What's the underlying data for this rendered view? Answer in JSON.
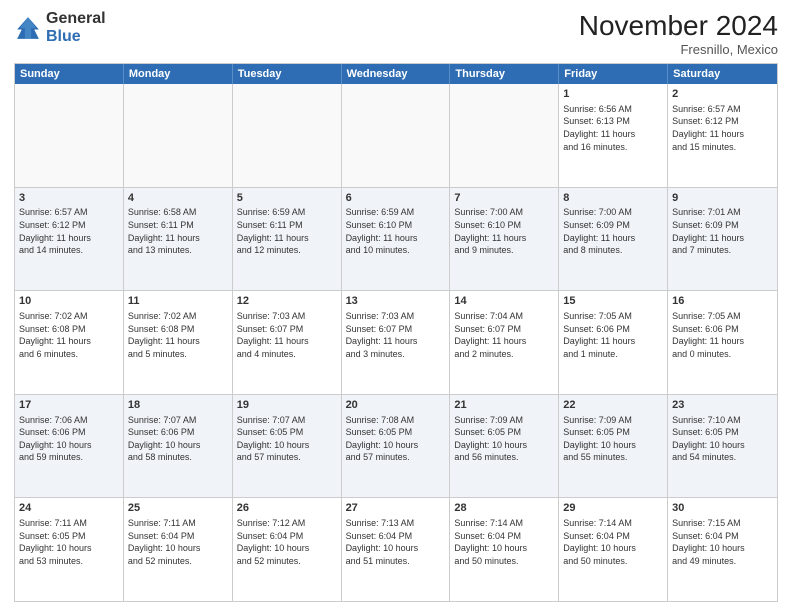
{
  "header": {
    "logo_general": "General",
    "logo_blue": "Blue",
    "month_title": "November 2024",
    "location": "Fresnillo, Mexico"
  },
  "weekdays": [
    "Sunday",
    "Monday",
    "Tuesday",
    "Wednesday",
    "Thursday",
    "Friday",
    "Saturday"
  ],
  "rows": [
    [
      {
        "day": "",
        "info": ""
      },
      {
        "day": "",
        "info": ""
      },
      {
        "day": "",
        "info": ""
      },
      {
        "day": "",
        "info": ""
      },
      {
        "day": "",
        "info": ""
      },
      {
        "day": "1",
        "info": "Sunrise: 6:56 AM\nSunset: 6:13 PM\nDaylight: 11 hours\nand 16 minutes."
      },
      {
        "day": "2",
        "info": "Sunrise: 6:57 AM\nSunset: 6:12 PM\nDaylight: 11 hours\nand 15 minutes."
      }
    ],
    [
      {
        "day": "3",
        "info": "Sunrise: 6:57 AM\nSunset: 6:12 PM\nDaylight: 11 hours\nand 14 minutes."
      },
      {
        "day": "4",
        "info": "Sunrise: 6:58 AM\nSunset: 6:11 PM\nDaylight: 11 hours\nand 13 minutes."
      },
      {
        "day": "5",
        "info": "Sunrise: 6:59 AM\nSunset: 6:11 PM\nDaylight: 11 hours\nand 12 minutes."
      },
      {
        "day": "6",
        "info": "Sunrise: 6:59 AM\nSunset: 6:10 PM\nDaylight: 11 hours\nand 10 minutes."
      },
      {
        "day": "7",
        "info": "Sunrise: 7:00 AM\nSunset: 6:10 PM\nDaylight: 11 hours\nand 9 minutes."
      },
      {
        "day": "8",
        "info": "Sunrise: 7:00 AM\nSunset: 6:09 PM\nDaylight: 11 hours\nand 8 minutes."
      },
      {
        "day": "9",
        "info": "Sunrise: 7:01 AM\nSunset: 6:09 PM\nDaylight: 11 hours\nand 7 minutes."
      }
    ],
    [
      {
        "day": "10",
        "info": "Sunrise: 7:02 AM\nSunset: 6:08 PM\nDaylight: 11 hours\nand 6 minutes."
      },
      {
        "day": "11",
        "info": "Sunrise: 7:02 AM\nSunset: 6:08 PM\nDaylight: 11 hours\nand 5 minutes."
      },
      {
        "day": "12",
        "info": "Sunrise: 7:03 AM\nSunset: 6:07 PM\nDaylight: 11 hours\nand 4 minutes."
      },
      {
        "day": "13",
        "info": "Sunrise: 7:03 AM\nSunset: 6:07 PM\nDaylight: 11 hours\nand 3 minutes."
      },
      {
        "day": "14",
        "info": "Sunrise: 7:04 AM\nSunset: 6:07 PM\nDaylight: 11 hours\nand 2 minutes."
      },
      {
        "day": "15",
        "info": "Sunrise: 7:05 AM\nSunset: 6:06 PM\nDaylight: 11 hours\nand 1 minute."
      },
      {
        "day": "16",
        "info": "Sunrise: 7:05 AM\nSunset: 6:06 PM\nDaylight: 11 hours\nand 0 minutes."
      }
    ],
    [
      {
        "day": "17",
        "info": "Sunrise: 7:06 AM\nSunset: 6:06 PM\nDaylight: 10 hours\nand 59 minutes."
      },
      {
        "day": "18",
        "info": "Sunrise: 7:07 AM\nSunset: 6:06 PM\nDaylight: 10 hours\nand 58 minutes."
      },
      {
        "day": "19",
        "info": "Sunrise: 7:07 AM\nSunset: 6:05 PM\nDaylight: 10 hours\nand 57 minutes."
      },
      {
        "day": "20",
        "info": "Sunrise: 7:08 AM\nSunset: 6:05 PM\nDaylight: 10 hours\nand 57 minutes."
      },
      {
        "day": "21",
        "info": "Sunrise: 7:09 AM\nSunset: 6:05 PM\nDaylight: 10 hours\nand 56 minutes."
      },
      {
        "day": "22",
        "info": "Sunrise: 7:09 AM\nSunset: 6:05 PM\nDaylight: 10 hours\nand 55 minutes."
      },
      {
        "day": "23",
        "info": "Sunrise: 7:10 AM\nSunset: 6:05 PM\nDaylight: 10 hours\nand 54 minutes."
      }
    ],
    [
      {
        "day": "24",
        "info": "Sunrise: 7:11 AM\nSunset: 6:05 PM\nDaylight: 10 hours\nand 53 minutes."
      },
      {
        "day": "25",
        "info": "Sunrise: 7:11 AM\nSunset: 6:04 PM\nDaylight: 10 hours\nand 52 minutes."
      },
      {
        "day": "26",
        "info": "Sunrise: 7:12 AM\nSunset: 6:04 PM\nDaylight: 10 hours\nand 52 minutes."
      },
      {
        "day": "27",
        "info": "Sunrise: 7:13 AM\nSunset: 6:04 PM\nDaylight: 10 hours\nand 51 minutes."
      },
      {
        "day": "28",
        "info": "Sunrise: 7:14 AM\nSunset: 6:04 PM\nDaylight: 10 hours\nand 50 minutes."
      },
      {
        "day": "29",
        "info": "Sunrise: 7:14 AM\nSunset: 6:04 PM\nDaylight: 10 hours\nand 50 minutes."
      },
      {
        "day": "30",
        "info": "Sunrise: 7:15 AM\nSunset: 6:04 PM\nDaylight: 10 hours\nand 49 minutes."
      }
    ]
  ]
}
